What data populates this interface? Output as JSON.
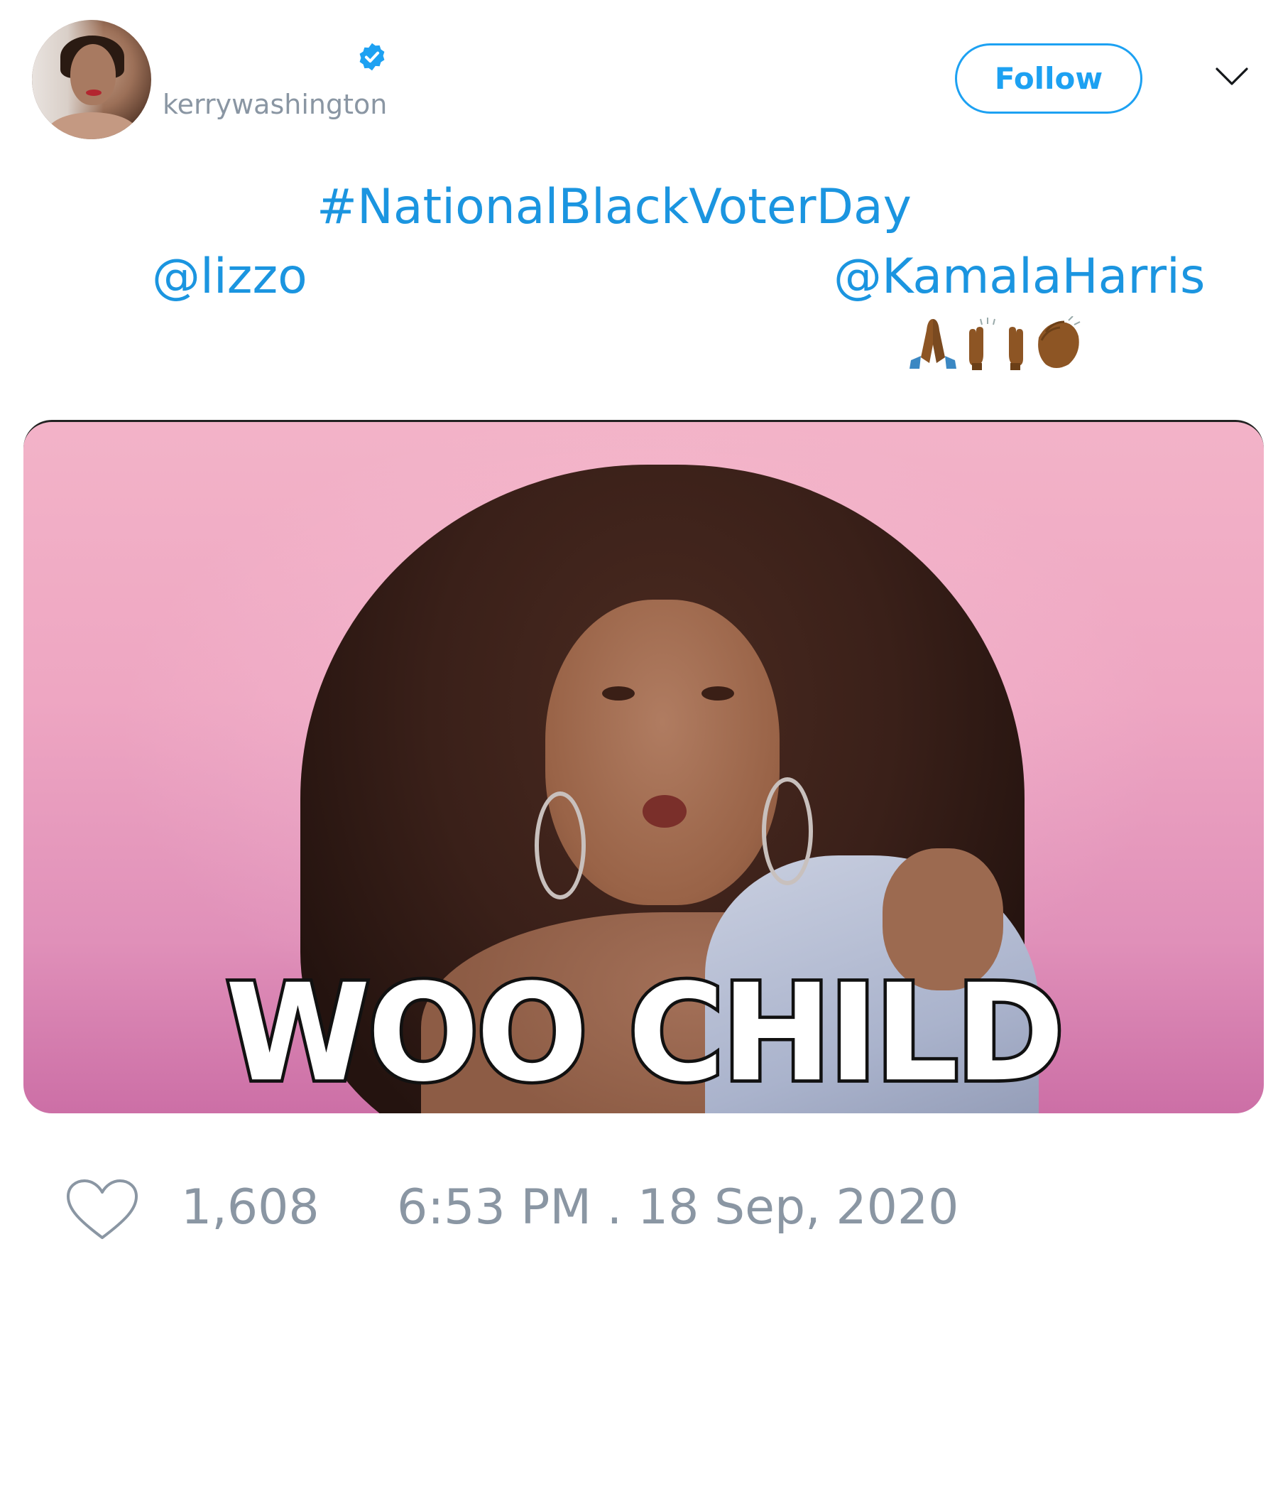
{
  "author": {
    "handle": "kerrywashington",
    "verified": true
  },
  "header": {
    "follow_label": "Follow"
  },
  "tweet": {
    "hashtag": "#NationalBlackVoterDay",
    "mention_1": "@lizzo",
    "mention_2": "@KamalaHarris",
    "emojis": [
      "folded-hands",
      "raising-hands",
      "clapping-hands"
    ]
  },
  "media": {
    "caption": "WOO CHILD"
  },
  "footer": {
    "like_count": "1,608",
    "timestamp": "6:53 PM . 18 Sep, 2020"
  },
  "colors": {
    "link": "#1b95e0",
    "follow": "#1da1f2",
    "muted": "#8a96a3",
    "verified": "#1da1f2"
  }
}
